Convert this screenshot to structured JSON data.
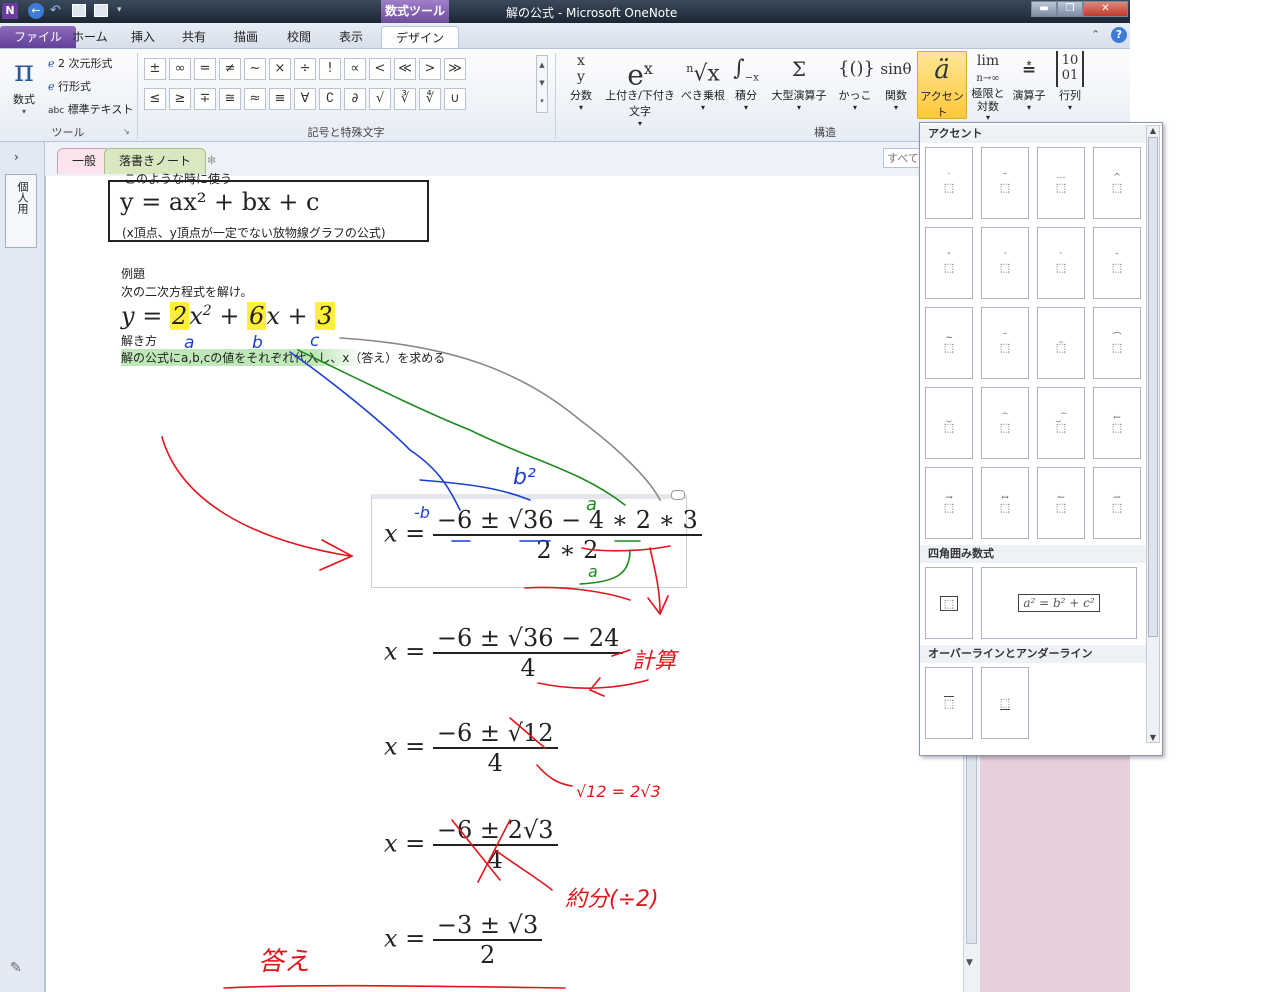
{
  "window": {
    "context_tab": "数式ツール",
    "title": "解の公式 - Microsoft OneNote",
    "app_icon": "N",
    "controls": [
      "minimize",
      "restore",
      "close"
    ]
  },
  "tabs": [
    "ファイル",
    "ホーム",
    "挿入",
    "共有",
    "描画",
    "校閲",
    "表示",
    "デザイン"
  ],
  "tools_group": {
    "equation_label": "数式",
    "options": [
      "2 次元形式",
      "行形式",
      "標準テキスト"
    ],
    "group_label": "ツール"
  },
  "symbols_group": {
    "row1": [
      "±",
      "∞",
      "=",
      "≠",
      "~",
      "×",
      "÷",
      "!",
      "∝",
      "<",
      "≪",
      ">",
      "≫"
    ],
    "row2": [
      "≤",
      "≥",
      "∓",
      "≅",
      "≈",
      "≡",
      "∀",
      "∁",
      "∂",
      "√",
      "∛",
      "∜",
      "∪"
    ],
    "group_label": "記号と特殊文字"
  },
  "structures": {
    "items": [
      {
        "glyph": "x/y",
        "label": "分数"
      },
      {
        "glyph": "eˣ",
        "label": "上付き/下付き文字"
      },
      {
        "glyph": "ⁿ√x",
        "label": "べき乗根"
      },
      {
        "glyph": "∫",
        "label": "積分"
      },
      {
        "glyph": "Σ",
        "label": "大型演算子"
      },
      {
        "glyph": "{()}",
        "label": "かっこ"
      },
      {
        "glyph": "sinθ",
        "label": "関数"
      },
      {
        "glyph": "ä",
        "label": "アクセント"
      },
      {
        "glyph": "lim",
        "label": "極限と対数"
      },
      {
        "glyph": "▵",
        "label": "演算子"
      },
      {
        "glyph": "[10/01]",
        "label": "行列"
      }
    ],
    "group_label": "構造"
  },
  "notebook": {
    "section_tabs": [
      "一般",
      "落書きノート"
    ],
    "search_placeholder": "すべて",
    "sidebar_label": "個人用"
  },
  "page": {
    "partial_top": "このような時に使う",
    "formula_box": "y = ax² + bx + c",
    "formula_note": "(x頂点、y頂点が一定でない放物線グラフの公式)",
    "example_title": "例題",
    "example_instruction": "次の二次方程式を解け。",
    "equation": {
      "y": "y",
      "a": "2",
      "b": "6",
      "c": "3"
    },
    "solve_title": "解き方",
    "solve_instruction": "解の公式にa,b,cの値をそれぞれ代入し、x（答え）を求める",
    "steps": [
      {
        "num": "−6 ± √36 − 4 ∗ 2 ∗ 3",
        "den": "2 ∗ 2"
      },
      {
        "num": "−6 ± √36 − 24",
        "den": "4"
      },
      {
        "num": "−6 ± √12",
        "den": "4"
      },
      {
        "num": "−6 ± 2√3",
        "den": "4"
      },
      {
        "num": "−3 ± √3",
        "den": "2"
      }
    ],
    "handwriting": {
      "a": "a",
      "b": "b",
      "c": "c",
      "b2": "b²",
      "minus_b": "-b",
      "a2": "a",
      "a3": "a",
      "keisan": "計算",
      "sqrt12": "√12 = 2√3",
      "yakubun": "約分(÷2)",
      "kotae": "答え"
    }
  },
  "accent_panel": {
    "title": "アクセント",
    "boxed_title": "四角囲み数式",
    "boxed_example": "a² = b² + c²",
    "overline_title": "オーバーラインとアンダーライン"
  },
  "colors": {
    "ribbon_purple": "#6e4c9e",
    "handwriting_red": "#e0161b",
    "handwriting_blue": "#1b3fd1",
    "handwriting_green": "#1f8a1f",
    "highlight_yellow": "#ffef3a",
    "pink_strip": "#e8cfdd"
  }
}
